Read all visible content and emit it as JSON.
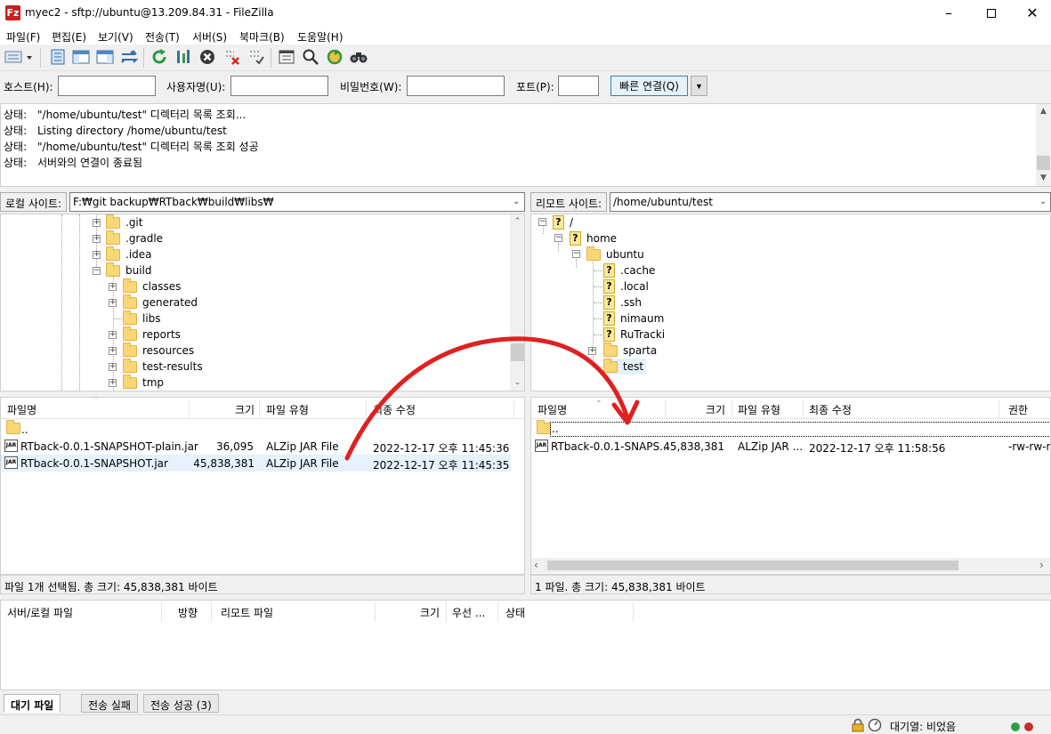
{
  "window": {
    "title": "myec2 - sftp://ubuntu@13.209.84.31 - FileZilla",
    "app_icon_text": "Fz"
  },
  "menu": [
    "파일(F)",
    "편집(E)",
    "보기(V)",
    "전송(T)",
    "서버(S)",
    "북마크(B)",
    "도움말(H)"
  ],
  "quickconnect": {
    "host_label": "호스트(H):",
    "user_label": "사용자명(U):",
    "password_label": "비밀번호(W):",
    "port_label": "포트(P):",
    "host_value": "",
    "user_value": "",
    "password_value": "",
    "port_value": "",
    "connect_label": "빠른 연결(Q)"
  },
  "log": [
    {
      "key": "상태:",
      "text": "\"/home/ubuntu/test\" 디렉터리 목록 조회..."
    },
    {
      "key": "상태:",
      "text": "Listing directory /home/ubuntu/test"
    },
    {
      "key": "상태:",
      "text": "\"/home/ubuntu/test\" 디렉터리 목록 조회 성공"
    },
    {
      "key": "상태:",
      "text": "서버와의 연결이 종료됨"
    }
  ],
  "local": {
    "site_label": "로컬 사이트:",
    "path": "F:₩git backup₩RTback₩build₩libs₩",
    "tree": [
      ".git",
      ".gradle",
      ".idea",
      "build",
      "classes",
      "generated",
      "libs",
      "reports",
      "resources",
      "test-results",
      "tmp"
    ],
    "headers": [
      "파일명",
      "크기",
      "파일 유형",
      "최종 수정"
    ],
    "parent": "..",
    "files": [
      {
        "name": "RTback-0.0.1-SNAPSHOT-plain.jar",
        "size": "36,095",
        "type": "ALZip JAR File",
        "modified": "2022-12-17 오후 11:45:36"
      },
      {
        "name": "RTback-0.0.1-SNAPSHOT.jar",
        "size": "45,838,381",
        "type": "ALZip JAR File",
        "modified": "2022-12-17 오후 11:45:35"
      }
    ],
    "status": "파일 1개 선택됨. 총 크기: 45,838,381 바이트"
  },
  "remote": {
    "site_label": "리모트 사이트:",
    "path": "/home/ubuntu/test",
    "tree": [
      "/",
      "home",
      "ubuntu",
      ".cache",
      ".local",
      ".ssh",
      "nimaum",
      "RuTracki",
      "sparta",
      "test"
    ],
    "headers": [
      "파일명",
      "크기",
      "파일 유형",
      "최종 수정",
      "권한"
    ],
    "parent": "..",
    "files": [
      {
        "name": "RTback-0.0.1-SNAPS...",
        "size": "45,838,381",
        "type": "ALZip JAR ...",
        "modified": "2022-12-17 오후 11:58:56",
        "perms": "-rw-rw-r-"
      }
    ],
    "status": "1 파일. 총 크기: 45,838,381 바이트"
  },
  "queue": {
    "headers": [
      "서버/로컬 파일",
      "방향",
      "리모트 파일",
      "크기",
      "우선 ...",
      "상태"
    ]
  },
  "tabs": [
    "대기 파일",
    "전송 실패",
    "전송 성공 (3)"
  ],
  "bottom": {
    "queue_status": "대기열: 비었음"
  },
  "icons": {
    "jar": "JAR"
  },
  "colors": {
    "arrow": "#e02020",
    "selection": "#e5f1fb",
    "folder": "#f8d775"
  }
}
